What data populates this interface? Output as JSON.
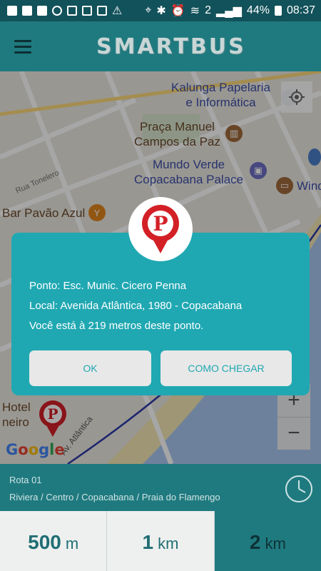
{
  "status_bar": {
    "battery": "44%",
    "time": "08:37",
    "notification_count": "2"
  },
  "app_bar": {
    "title": "SMARTBUS"
  },
  "map": {
    "labels": {
      "kalunga": "Kalunga Papelaria\ne Informática",
      "praca": "Praça Manuel\nCampos da Paz",
      "mundo_verde": "Mundo Verde\nCopacabana Palace",
      "windsor": "Wind",
      "rua_tonelero": "Rua Tonelero",
      "bar_pavao": "Bar Pavão Azul",
      "hotel": "Hotel\nneiro",
      "avenida": "Av. Atlântica"
    },
    "attribution": "Google"
  },
  "dialog": {
    "stop_line": "Ponto: Esc. Munic. Cicero Penna",
    "location_line": "Local: Avenida Atlântica, 1980 - Copacabana",
    "distance_line": "Você está à 219 metros deste ponto.",
    "ok_label": "OK",
    "directions_label": "COMO CHEGAR"
  },
  "route": {
    "name": "Rota 01",
    "path": "Riviera / Centro / Copacabana / Praia do Flamengo"
  },
  "distance_tabs": [
    {
      "value": "500",
      "unit": "m",
      "active": false
    },
    {
      "value": "1",
      "unit": "km",
      "active": false
    },
    {
      "value": "2",
      "unit": "km",
      "active": true
    }
  ],
  "colors": {
    "primary": "#1f7a7f",
    "dark_primary": "#12525a",
    "dialog": "#20a8b2",
    "pin_red": "#d32027"
  }
}
